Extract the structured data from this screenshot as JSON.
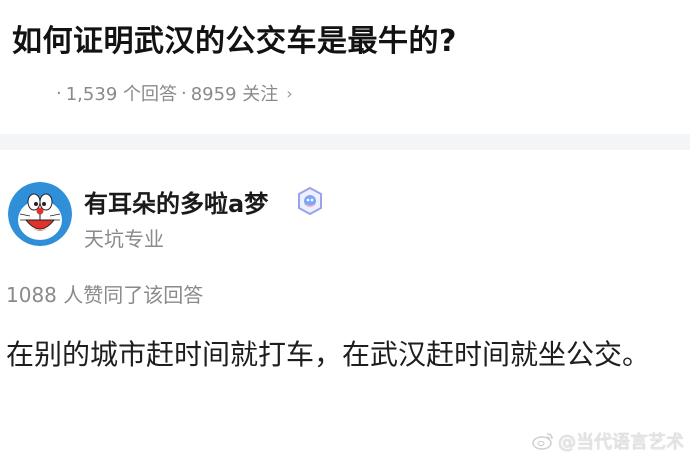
{
  "question": {
    "title": "如何证明武汉的公交车是最牛的?",
    "answers_count": "1,539 个回答",
    "followers_count": "8959 关注"
  },
  "answer": {
    "author_name": "有耳朵的多啦a梦",
    "author_headline": "天坑专业",
    "vote_text": "1088 人赞同了该回答",
    "content": "在别的城市赶时间就打车，在武汉赶时间就坐公交。"
  },
  "watermark": {
    "text": "@当代语言艺术"
  },
  "icons": {
    "avatar": "doraemon-avatar-icon",
    "badge": "verified-badge-icon",
    "chevron": "chevron-right-icon",
    "watermark_logo": "weibo-logo-icon"
  }
}
